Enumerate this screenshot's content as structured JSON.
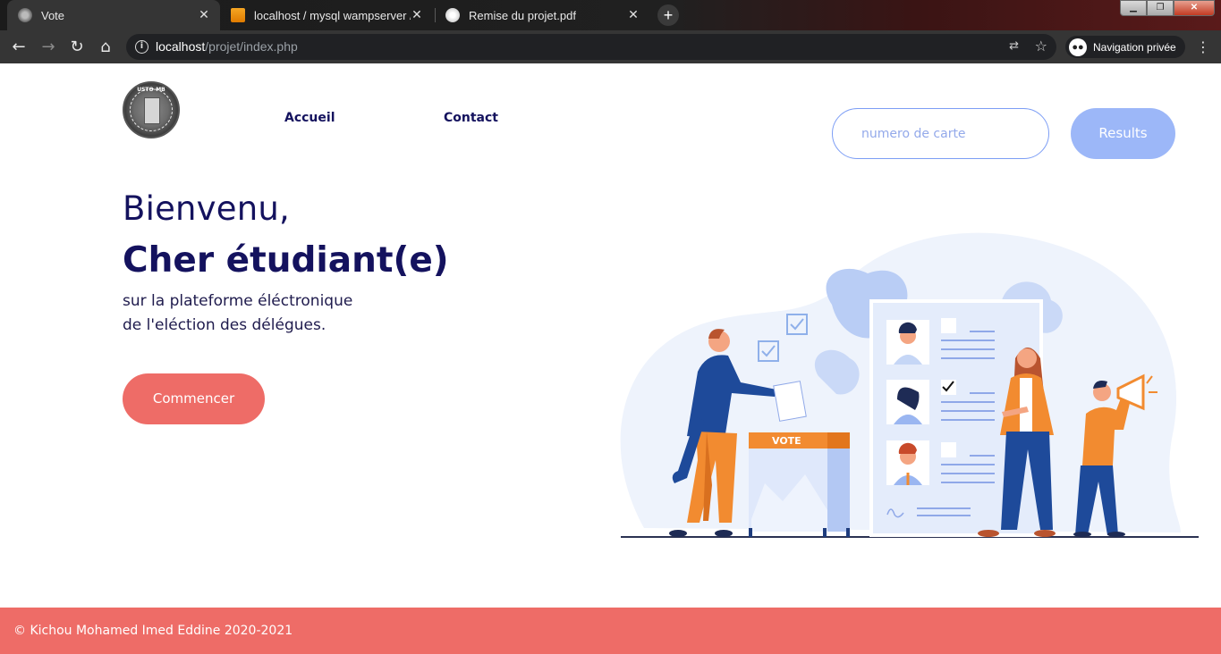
{
  "browser": {
    "tabs": [
      {
        "title": "Vote",
        "active": true,
        "favicon": "globe-grey-icon"
      },
      {
        "title": "localhost / mysql wampserver / in",
        "active": false,
        "favicon": "phpmyadmin-icon"
      },
      {
        "title": "Remise du projet.pdf",
        "active": false,
        "favicon": "globe-icon"
      }
    ],
    "new_tab_symbol": "+",
    "close_symbol": "✕",
    "url_host": "localhost",
    "url_path": "/projet/index.php",
    "incognito_label": "Navigation privée",
    "window_buttons": [
      "minimize",
      "maximize",
      "close"
    ]
  },
  "site": {
    "logo_text": "USTO-MB",
    "nav": {
      "home": "Accueil",
      "contact": "Contact"
    },
    "search": {
      "placeholder": "numero de carte",
      "button": "Results"
    },
    "hero": {
      "greeting": "Bienvenu,",
      "headline": "Cher étudiant(e)",
      "line1": "sur la plateforme éléctronique",
      "line2": "de l'eléction des délégues.",
      "cta": "Commencer"
    },
    "illustration": {
      "ballot_box_label": "VOTE"
    },
    "footer": "© Kichou Mohamed Imed Eddine 2020-2021"
  },
  "colors": {
    "navy": "#14125e",
    "coral": "#ee6c67",
    "light_blue": "#9cb7f8",
    "accent_orange": "#f28b30",
    "illustration_blue": "#1e4a9a"
  }
}
